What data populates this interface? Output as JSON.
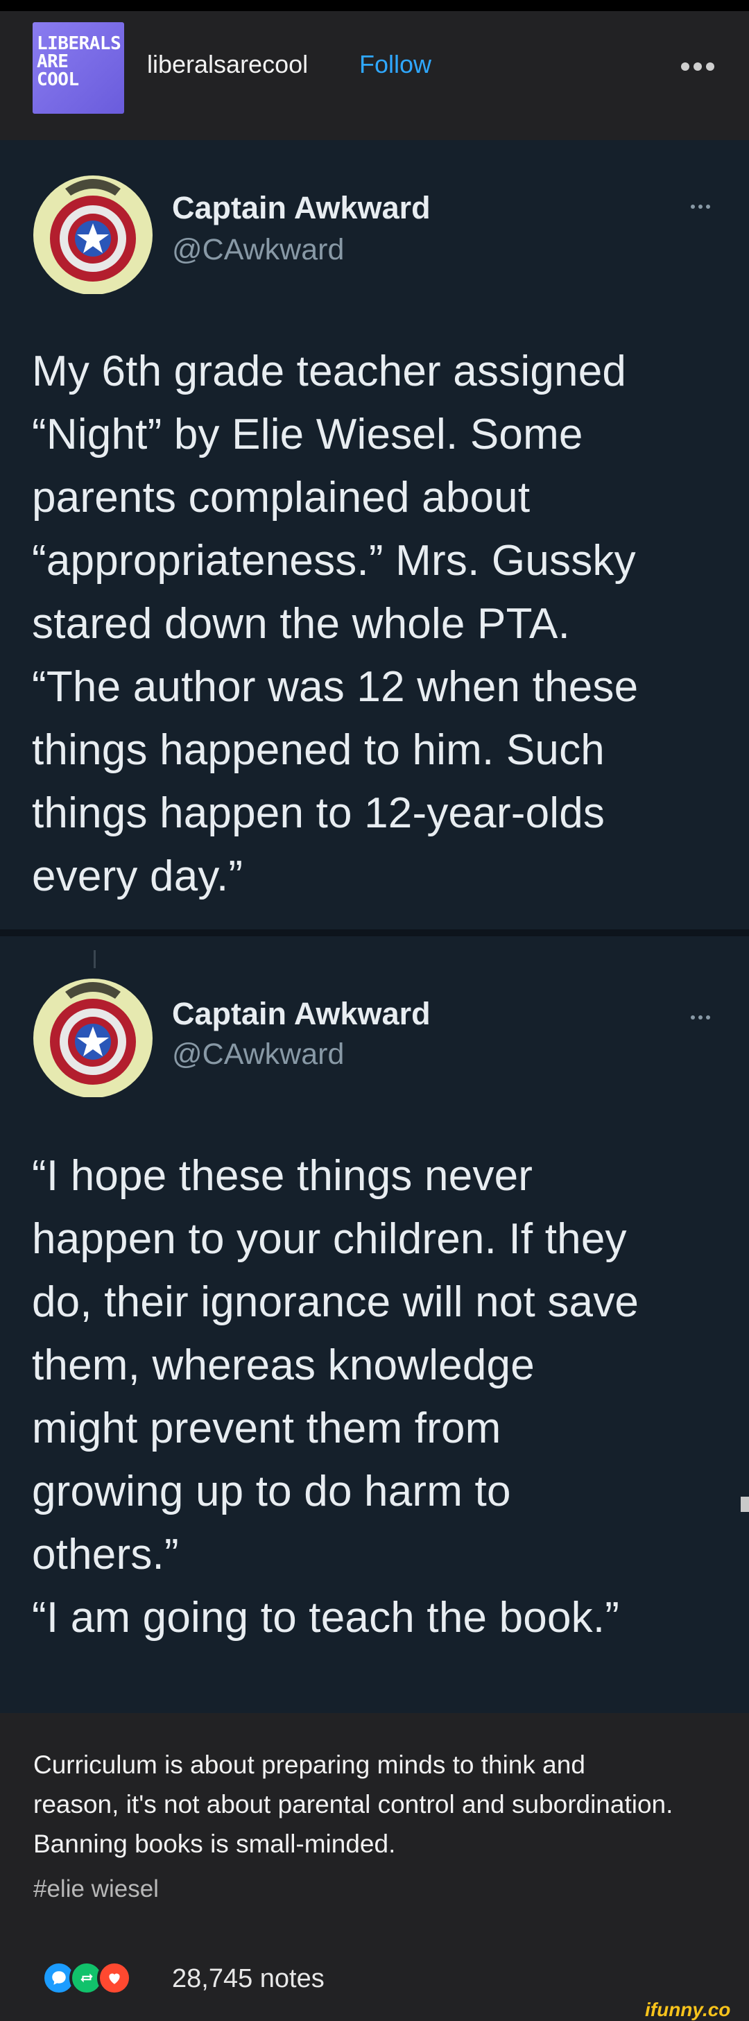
{
  "header": {
    "logo_lines": [
      "LIBERALS",
      "ARE",
      "COOL"
    ],
    "blog_name": "liberalsarecool",
    "follow_label": "Follow"
  },
  "tweets": [
    {
      "name": "Captain Awkward",
      "handle": "@CAwkward",
      "text": "My 6th grade teacher assigned\n“Night” by Elie Wiesel. Some\nparents complained about\n“appropriateness.” Mrs. Gussky\nstared down the whole PTA.\n“The author was 12 when these\nthings happened to him. Such\nthings happen to 12-year-olds\nevery day.”"
    },
    {
      "name": "Captain Awkward",
      "handle": "@CAwkward",
      "text": "“I hope these things never\nhappen to your children. If they\ndo, their ignorance will not save\nthem, whereas knowledge\nmight prevent them from\ngrowing up to do harm to\nothers.”\n“I am going to teach the book.”"
    }
  ],
  "caption": {
    "text": "Curriculum is about preparing minds to think and\nreason, it's not about parental control and subordination.\nBanning books is small-minded.",
    "tag": "#elie wiesel"
  },
  "notes": {
    "count_label": "28,745 notes",
    "icons": [
      "comment-icon",
      "reblog-icon",
      "heart-icon"
    ],
    "colors": {
      "comment": "#1b9cff",
      "reblog": "#11c26b",
      "heart": "#ff4930"
    }
  },
  "watermark": "ifunny.co",
  "colors": {
    "tweet_bg": "#15202b",
    "tumblr_bg": "#222224",
    "follow": "#2fa8ff"
  }
}
